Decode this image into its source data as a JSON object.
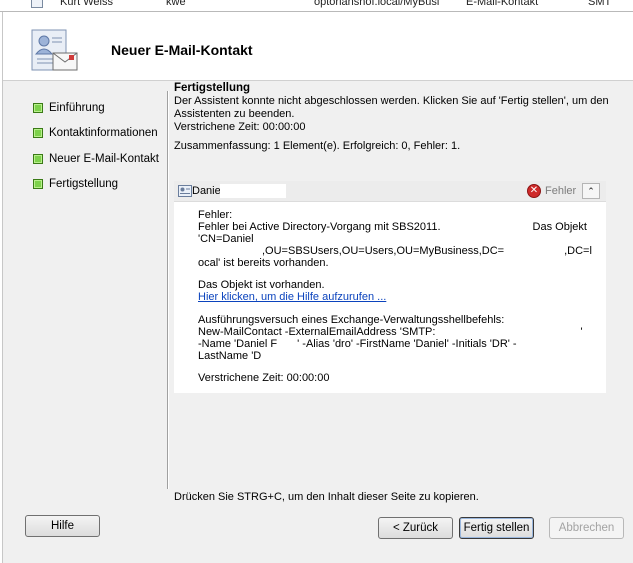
{
  "background_row": [
    "Kurt Weiss",
    "kwe",
    "optorianshof.local/MyBusi",
    "E-Mail-Kontakt",
    "SMT"
  ],
  "header": {
    "title": "Neuer E-Mail-Kontakt",
    "icon": "mail-contact-icon"
  },
  "nav": {
    "items": [
      {
        "label": "Einführung"
      },
      {
        "label": "Kontaktinformationen"
      },
      {
        "label": "Neuer E-Mail-Kontakt"
      },
      {
        "label": "Fertigstellung"
      }
    ]
  },
  "content": {
    "section_title": "Fertigstellung",
    "message_line1": "Der Assistent konnte nicht abgeschlossen werden. Klicken Sie auf 'Fertig stellen', um den",
    "message_line2": "Assistenten zu beenden.",
    "elapsed": "Verstrichene Zeit: 00:00:00",
    "summary": "Zusammenfassung: 1 Element(e). Erfolgreich: 0, Fehler: 1."
  },
  "panel": {
    "item_name": "Danie",
    "status_label": "Fehler",
    "collapse_glyph": "⌃",
    "error_heading": "Fehler:",
    "error_line1a": "Fehler bei Active Directory-Vorgang mit SBS2011.",
    "error_line1b": "Das Objekt",
    "error_line2": "'CN=Daniel",
    "error_line3a": ",OU=SBSUsers,OU=Users,OU=MyBusiness,DC=",
    "error_line3b": ",DC=l",
    "error_line4": "ocal' ist bereits vorhanden.",
    "exists": "Das Objekt ist vorhanden.",
    "help_link": "Hier klicken, um die Hilfe aufzurufen ...",
    "attempt_heading": "Ausführungsversuch eines Exchange-Verwaltungsshellbefehls:",
    "cmd_line1a": "New-MailContact -ExternalEmailAddress 'SMTP:",
    "cmd_line1b": "'",
    "cmd_line2a": "-Name 'Daniel F",
    "cmd_line2b": "' -Alias 'dro' -FirstName 'Daniel' -Initials 'DR' -",
    "cmd_line3": "LastName 'D",
    "elapsed": "Verstrichene Zeit: 00:00:00"
  },
  "copy_hint": "Drücken Sie STRG+C, um den Inhalt dieser Seite zu kopieren.",
  "buttons": {
    "help": "Hilfe",
    "back": "< Zurück",
    "finish": "Fertig stellen",
    "cancel": "Abbrechen"
  },
  "colors": {
    "nav_done": "#7dd14b",
    "link": "#0b43bd",
    "error": "#cf2a2a"
  }
}
